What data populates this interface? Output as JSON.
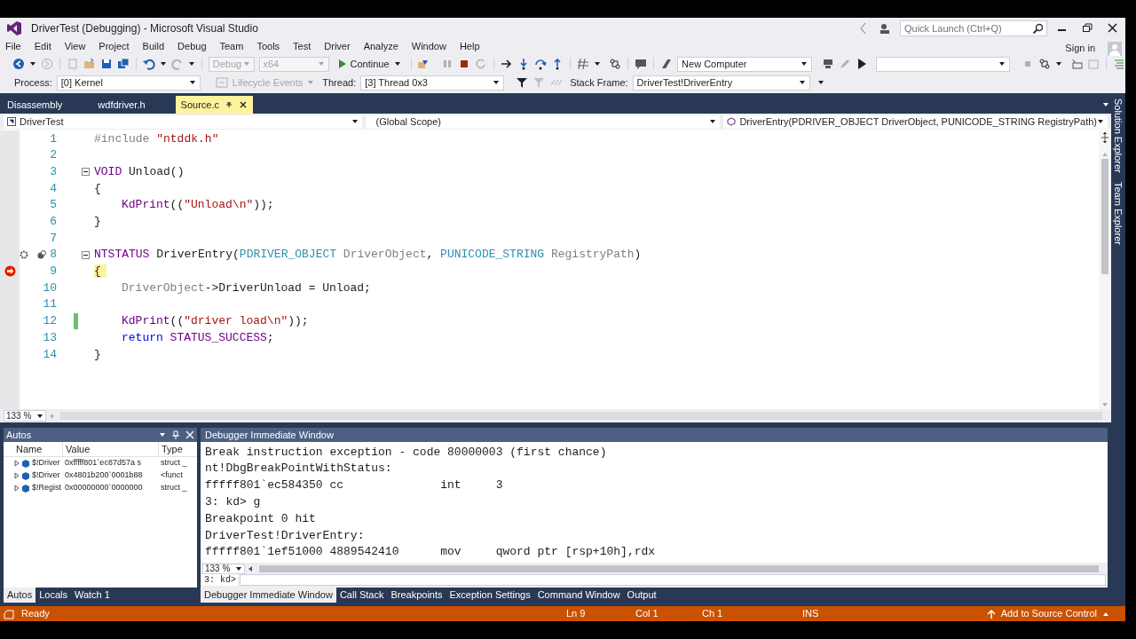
{
  "window": {
    "title": "DriverTest (Debugging) - Microsoft Visual Studio"
  },
  "quick_launch": {
    "placeholder": "Quick Launch (Ctrl+Q)"
  },
  "sign_in": "Sign in",
  "menu": [
    "File",
    "Edit",
    "View",
    "Project",
    "Build",
    "Debug",
    "Team",
    "Tools",
    "Test",
    "Driver",
    "Analyze",
    "Window",
    "Help"
  ],
  "toolbar": {
    "configuration": {
      "value": "Debug",
      "disabled": true
    },
    "platform": {
      "value": "x64",
      "disabled": true
    },
    "continue": "Continue",
    "target": {
      "value": "New Computer"
    }
  },
  "debug_location": {
    "process_label": "Process:",
    "process": "[0] Kernel",
    "lifecycle": {
      "label": "Lifecycle Events",
      "disabled": true
    },
    "thread_label": "Thread:",
    "thread": "[3] Thread 0x3",
    "stack_label": "Stack Frame:",
    "stack": "DriverTest!DriverEntry"
  },
  "document_tabs": [
    {
      "label": "Disassembly",
      "selected": false
    },
    {
      "label": "wdfdriver.h",
      "selected": false
    },
    {
      "label": "Source.c",
      "selected": true
    }
  ],
  "navigation": {
    "project": "DriverTest",
    "scope": "(Global Scope)",
    "member": "DriverEntry(PDRIVER_OBJECT DriverObject, PUNICODE_STRING RegistryPath)"
  },
  "editor": {
    "zoom": "133 %",
    "lines": [
      {
        "number": "1",
        "segments": [
          {
            "text": "#include ",
            "kind": "preproc"
          },
          {
            "text": "\"ntddk.h\"",
            "kind": "string"
          }
        ]
      },
      {
        "number": "2"
      },
      {
        "number": "3",
        "fold": true,
        "segments": [
          {
            "text": "VOID",
            "kind": "macro"
          },
          {
            "text": " Unload()",
            "kind": "plain"
          }
        ]
      },
      {
        "number": "4",
        "segments": [
          {
            "text": "{",
            "kind": "plain"
          }
        ]
      },
      {
        "number": "5",
        "indented": true,
        "segments": [
          {
            "text": "KdPrint",
            "kind": "macro"
          },
          {
            "text": "((",
            "kind": "plain"
          },
          {
            "text": "\"Unload\\n\"",
            "kind": "string"
          },
          {
            "text": "));",
            "kind": "plain"
          }
        ]
      },
      {
        "number": "6",
        "segments": [
          {
            "text": "}",
            "kind": "plain"
          }
        ]
      },
      {
        "number": "7"
      },
      {
        "number": "8",
        "fold": true,
        "lens": true,
        "segments": [
          {
            "text": "NTSTATUS",
            "kind": "macro"
          },
          {
            "text": " DriverEntry(",
            "kind": "plain"
          },
          {
            "text": "PDRIVER_OBJECT",
            "kind": "type"
          },
          {
            "text": " DriverObject",
            "kind": "param"
          },
          {
            "text": ", ",
            "kind": "plain"
          },
          {
            "text": "PUNICODE_STRING",
            "kind": "type"
          },
          {
            "text": " RegistryPath",
            "kind": "param"
          },
          {
            "text": ")",
            "kind": "plain"
          }
        ]
      },
      {
        "number": "9",
        "current": true,
        "segments": [
          {
            "text": "{",
            "kind": "current"
          }
        ]
      },
      {
        "number": "10",
        "indented": true,
        "segments": [
          {
            "text": "DriverObject",
            "kind": "param"
          },
          {
            "text": "->DriverUnload = Unload;",
            "kind": "plain"
          }
        ]
      },
      {
        "number": "11"
      },
      {
        "number": "12",
        "changed": true,
        "indented": true,
        "segments": [
          {
            "text": "KdPrint",
            "kind": "macro"
          },
          {
            "text": "((",
            "kind": "plain"
          },
          {
            "text": "\"driver load\\n\"",
            "kind": "string"
          },
          {
            "text": "));",
            "kind": "plain"
          }
        ]
      },
      {
        "number": "13",
        "indented": true,
        "segments": [
          {
            "text": "return",
            "kind": "keyword"
          },
          {
            "text": " STATUS_SUCCESS",
            "kind": "macro"
          },
          {
            "text": ";",
            "kind": "plain"
          }
        ]
      },
      {
        "number": "14",
        "segments": [
          {
            "text": "}",
            "kind": "plain"
          }
        ]
      }
    ]
  },
  "side_tabs": [
    "Solution Explorer",
    "Team Explorer"
  ],
  "autos": {
    "title": "Autos",
    "columns": [
      "Name",
      "Value",
      "Type"
    ],
    "rows": [
      [
        "$!Driver",
        "0xfffff801`ec87d57a s",
        "struct _"
      ],
      [
        "$!Driver",
        "0x4801b200`0001b88",
        "<funct"
      ],
      [
        "$!Regist",
        "0x00000000`0000000",
        "struct _"
      ]
    ]
  },
  "autos_tabs": [
    {
      "label": "Autos",
      "selected": true
    },
    {
      "label": "Locals",
      "selected": false
    },
    {
      "label": "Watch 1",
      "selected": false
    }
  ],
  "immediate": {
    "title": "Debugger Immediate Window",
    "zoom": "133 %",
    "prompt": "3: kd>",
    "lines": [
      "Break instruction exception - code 80000003 (first chance)",
      "nt!DbgBreakPointWithStatus:",
      "fffff801`ec584350 cc              int     3",
      "3: kd> g",
      "Breakpoint 0 hit",
      "DriverTest!DriverEntry:",
      "fffff801`1ef51000 4889542410      mov     qword ptr [rsp+10h],rdx"
    ]
  },
  "bottom_tabs": [
    {
      "label": "Debugger Immediate Window",
      "selected": true
    },
    {
      "label": "Call Stack",
      "selected": false
    },
    {
      "label": "Breakpoints",
      "selected": false
    },
    {
      "label": "Exception Settings",
      "selected": false
    },
    {
      "label": "Command Window",
      "selected": false
    },
    {
      "label": "Output",
      "selected": false
    }
  ],
  "status_bar": {
    "state": "Ready",
    "line": "Ln 9",
    "column": "Col 1",
    "char": "Ch 1",
    "mode": "INS",
    "source_control": "Add to Source Control"
  }
}
